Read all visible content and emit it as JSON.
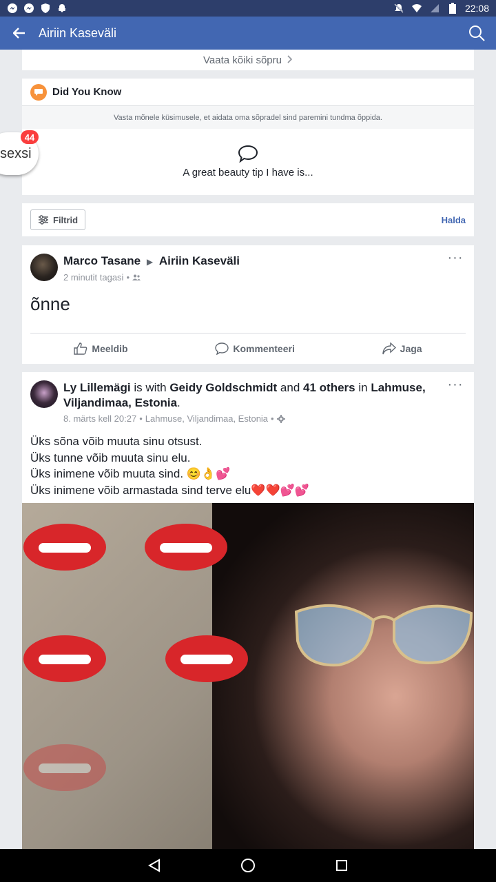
{
  "status_bar": {
    "time": "22:08",
    "left_icons": [
      "messenger-icon",
      "messenger-icon",
      "shield-icon",
      "snapchat-icon"
    ],
    "right_icons": [
      "mute-icon",
      "wifi-icon",
      "signal-icon",
      "battery-icon"
    ]
  },
  "app_bar": {
    "title": "Airiin Kaseväli",
    "color": "#4267b2"
  },
  "friends": {
    "see_all": "Vaata kõiki sõpru"
  },
  "did_you_know": {
    "title": "Did You Know",
    "subtitle": "Vasta mõnele küsimusele, et aidata oma sõpradel sind paremini tundma õppida.",
    "prompt": "A great beauty tip I have is..."
  },
  "filter_bar": {
    "filter_label": "Filtrid",
    "manage_label": "Halda"
  },
  "post1": {
    "author": "Marco Tasane",
    "target": "Airiin Kaseväli",
    "time": "2 minutit tagasi",
    "privacy_icon": "friends-icon",
    "body": "õnne",
    "actions": {
      "like": "Meeldib",
      "comment": "Kommenteeri",
      "share": "Jaga"
    }
  },
  "post2": {
    "author": "Ly Lillemägi",
    "is_with": "is with",
    "tagged": "Geidy Goldschmidt",
    "and": "and",
    "others": "41 others",
    "in": "in",
    "place": "Lahmuse, Viljandimaa, Estonia",
    "period": ".",
    "time": "8. märts kell 20:27",
    "location": "Lahmuse, Viljandimaa, Estonia",
    "lines": [
      "Üks sõna võib muuta sinu otsust.",
      "Üks tunne võib muuta sinu elu.",
      "Üks inimene võib muuta sind. 😊👌💕",
      "Üks inimene võib armastada sind terve elu❤️❤️💕💕"
    ]
  },
  "chat_head": {
    "label": "sexsi",
    "badge": "44"
  }
}
